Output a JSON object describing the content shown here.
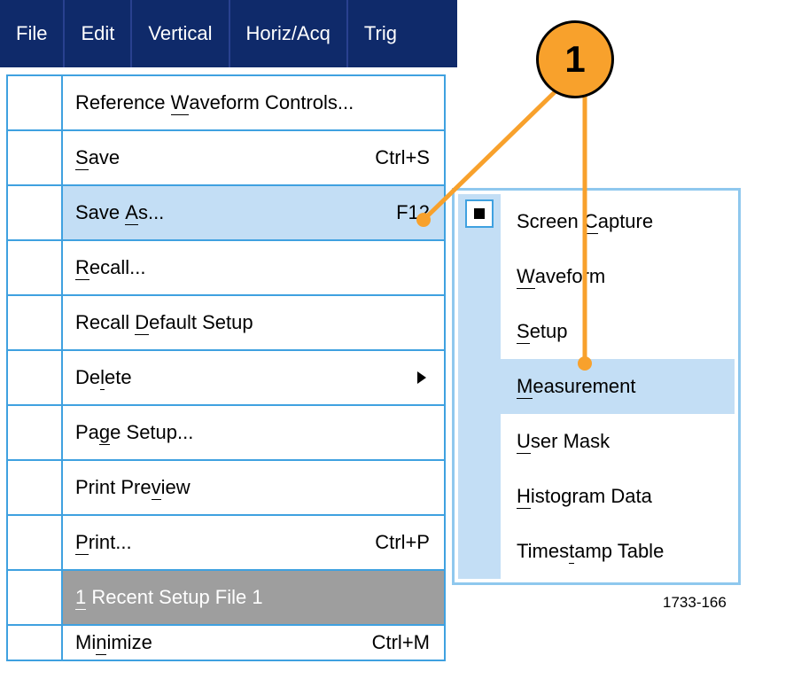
{
  "menubar": {
    "file": "File",
    "edit": "Edit",
    "vertical": "Vertical",
    "horiz_acq": "Horiz/Acq",
    "trig": "Trig"
  },
  "file_menu": {
    "ref_wave_pre": "Reference ",
    "ref_wave_mn": "W",
    "ref_wave_post": "aveform Controls...",
    "save_mn": "S",
    "save_post": "ave",
    "save_shortcut": "Ctrl+S",
    "saveas_pre": "Save ",
    "saveas_mn": "A",
    "saveas_post": "s...",
    "saveas_shortcut": "F12",
    "recall_mn": "R",
    "recall_post": "ecall...",
    "recall_default_pre": "Recall ",
    "recall_default_mn": "D",
    "recall_default_post": "efault Setup",
    "delete_pre": "De",
    "delete_mn": "l",
    "delete_post": "ete",
    "page_setup_pre": "Pa",
    "page_setup_mn": "g",
    "page_setup_post": "e Setup...",
    "print_preview_pre": "Print Pre",
    "print_preview_mn": "v",
    "print_preview_post": "iew",
    "print_mn": "P",
    "print_post": "rint...",
    "print_shortcut": "Ctrl+P",
    "recent_mn": "1",
    "recent_post": " Recent Setup File 1",
    "minimize_pre": "Mi",
    "minimize_mn": "n",
    "minimize_post": "imize",
    "minimize_shortcut": "Ctrl+M"
  },
  "submenu": {
    "screen_pre": "Screen ",
    "screen_mn": "C",
    "screen_post": "apture",
    "wave_mn": "W",
    "wave_post": "aveform",
    "setup_mn": "S",
    "setup_post": "etup",
    "meas_mn": "M",
    "meas_post": "easurement",
    "user_mn": "U",
    "user_post": "ser Mask",
    "hist_mn": "H",
    "hist_post": "istogram Data",
    "timestamp_pre": "Times",
    "timestamp_mn": "t",
    "timestamp_post": "amp Table"
  },
  "callout": {
    "label": "1"
  },
  "figure_id": "1733-166"
}
